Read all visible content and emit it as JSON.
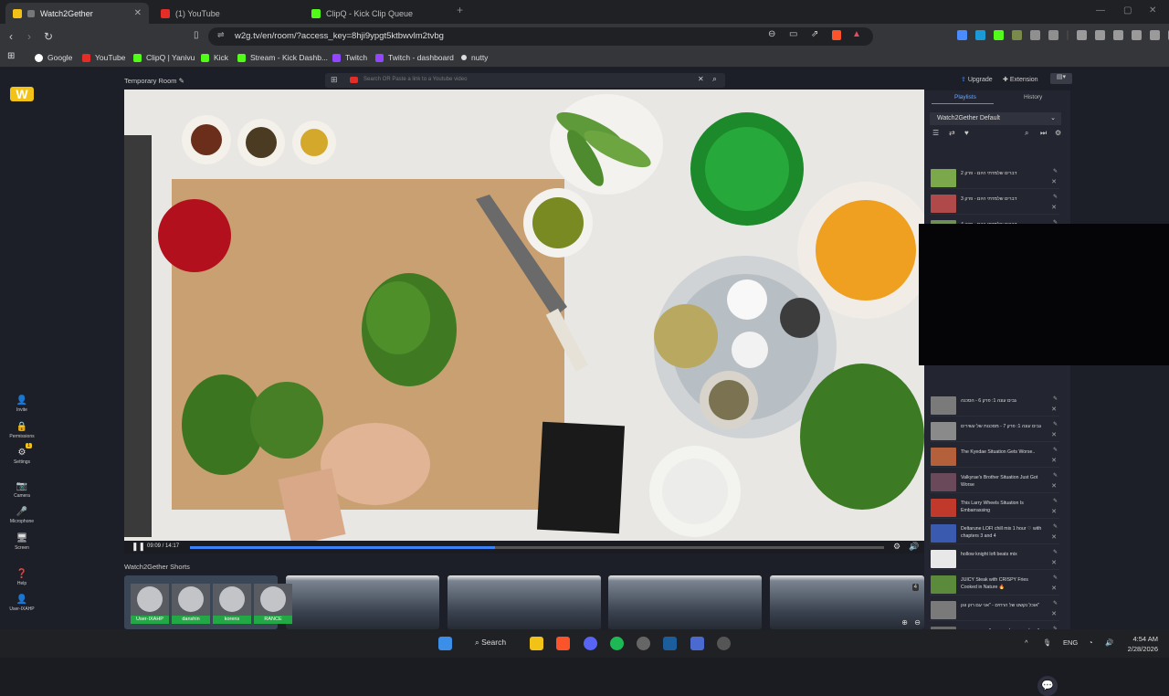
{
  "browser": {
    "tabs": [
      {
        "title": "Watch2Gether",
        "color": "#f2c216"
      },
      {
        "title": "(1) YouTube",
        "color": "#e52d27"
      },
      {
        "title": "ClipQ - Kick Clip Queue",
        "color": "#53fc18"
      }
    ],
    "url": "w2g.tv/en/room/?access_key=8hji9ypgt5ktbwvlm2tvbg",
    "bookmarks": [
      {
        "label": "Google",
        "color": "#ffffff"
      },
      {
        "label": "YouTube",
        "color": "#e52d27"
      },
      {
        "label": "ClipQ | Yanivu",
        "color": "#53fc18"
      },
      {
        "label": "Kick",
        "color": "#53fc18"
      },
      {
        "label": "Stream - Kick Dashb...",
        "color": "#53fc18"
      },
      {
        "label": "Twitch",
        "color": "#9146ff"
      },
      {
        "label": "Twitch - dashboard",
        "color": "#9146ff"
      },
      {
        "label": "nutty",
        "color": "#dddddd"
      }
    ]
  },
  "room": {
    "title": "Temporary Room",
    "search_placeholder": "Search OR Paste a link to a Youtube video",
    "upgrade": "Upgrade",
    "extension": "Extension"
  },
  "leftnav": [
    {
      "label": "Invite",
      "icon": "invite-icon"
    },
    {
      "label": "Permissions",
      "icon": "lock-icon"
    },
    {
      "label": "Settings",
      "icon": "gear-icon",
      "badge": "1"
    },
    {
      "label": "Camera",
      "icon": "camera-icon"
    },
    {
      "label": "Microphone",
      "icon": "microphone-icon"
    },
    {
      "label": "Screen",
      "icon": "screen-icon"
    },
    {
      "label": "Help",
      "icon": "help-icon"
    },
    {
      "label": "User-IXAHP",
      "icon": "user-icon"
    }
  ],
  "player": {
    "time": "09:09 / 14:17",
    "progress_pct": 44
  },
  "shorts": {
    "title": "Watch2Gether Shorts",
    "count": "4"
  },
  "users": [
    "User-IXAHP",
    "danshin",
    "korens",
    "RANCE"
  ],
  "sidebar": {
    "tab_playlists": "Playlists",
    "tab_history": "History",
    "playlist_name": "Watch2Gether Default",
    "items": [
      {
        "title": "דברים שלמדתי היום - פרק 2",
        "color": "#7ba84a"
      },
      {
        "title": "דברים שלמדתי היום - פרק 3",
        "color": "#b04a4a"
      },
      {
        "title": "דברים שלמדתי היום - פרק 4",
        "color": "#6f8f55"
      },
      {
        "title": "גבים עונה 1: פרק 6 - הסכנה",
        "color": "#7a7a7a"
      },
      {
        "title": "גבים עונה 1: פרק 7 - מסכנות של עשירים",
        "color": "#8a8a8a"
      },
      {
        "title": "The Kyedae Situation Gets Worse..",
        "color": "#b3603b"
      },
      {
        "title": "Valkyrae's Brother Situation Just Got Worse",
        "color": "#6a4a5a"
      },
      {
        "title": "This Larry Wheels Situation Is Embarrassing",
        "color": "#c0392b"
      },
      {
        "title": "Deltarune LOFI chill mix 1 hour ♡ with chapters 3 and 4",
        "color": "#3a5ab0"
      },
      {
        "title": "hollow knight lofi beats mix",
        "color": "#e8e8e8"
      },
      {
        "title": "JUICY Steak with CRISPY Fries Cooked in Nature 🔥",
        "color": "#5a8a3a"
      },
      {
        "title": "אוכל נקשט של הרחים - \"אני עם רוק ווגן\"",
        "color": "#7a7a7a"
      },
      {
        "title": "אוכל נקשט של הרחים - \"אני עם רוק ווגן\"",
        "color": "#6a6a6a"
      }
    ]
  },
  "taskbar": {
    "search": "Search",
    "lang": "ENG",
    "time": "4:54 AM",
    "date": "2/28/2026"
  }
}
